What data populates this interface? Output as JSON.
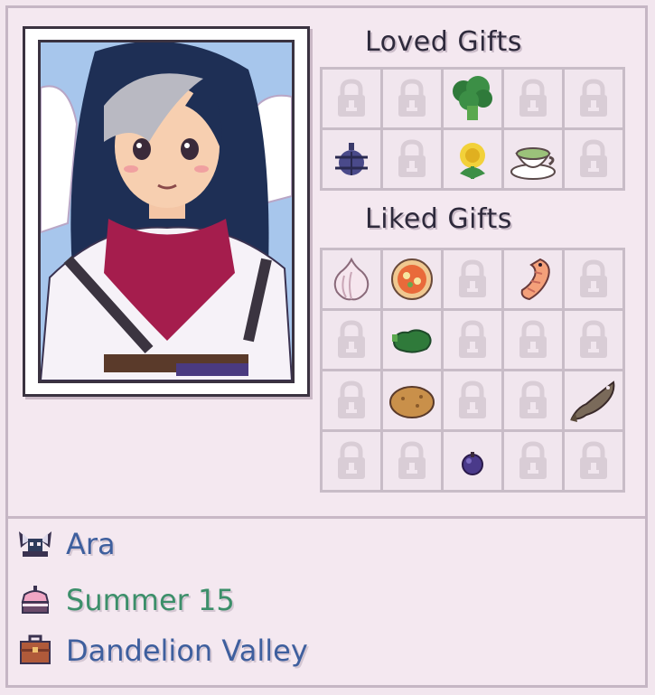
{
  "sections": {
    "loved_title": "Loved Gifts",
    "liked_title": "Liked Gifts"
  },
  "loved_gifts": [
    [
      "locked",
      "locked",
      "broccoli",
      "locked",
      "locked"
    ],
    [
      "beetle",
      "locked",
      "dandelion",
      "tea",
      "locked"
    ]
  ],
  "liked_gifts": [
    [
      "garlic",
      "pizza",
      "locked",
      "shrimp",
      "locked"
    ],
    [
      "locked",
      "pepper",
      "locked",
      "locked",
      "locked"
    ],
    [
      "locked",
      "potato",
      "locked",
      "locked",
      "fish"
    ],
    [
      "locked",
      "locked",
      "berry",
      "locked",
      "locked"
    ]
  ],
  "info": {
    "name": "Ara",
    "birthday": "Summer 15",
    "location": "Dandelion Valley",
    "name_color": "#3e5f9e",
    "birthday_color": "#3c8f6a",
    "location_color": "#3e5f9e"
  }
}
